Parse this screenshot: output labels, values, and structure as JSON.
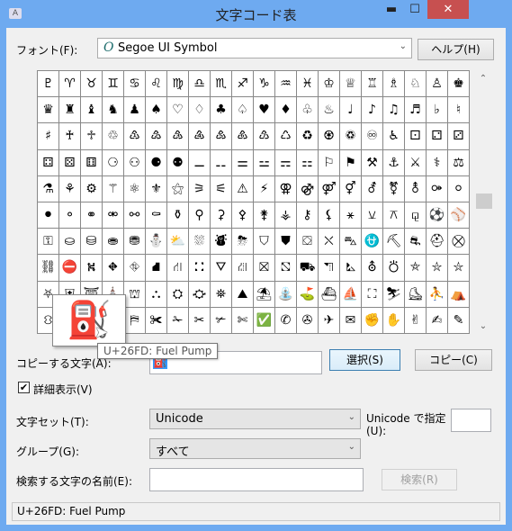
{
  "window": {
    "title": "文字コード表",
    "minimize": "▬",
    "maximize": "☐",
    "close": "✕",
    "app_icon": "A"
  },
  "font": {
    "label": "フォント(F):",
    "value": "Segoe UI Symbol",
    "font_icon": "O",
    "arrow": "⌄"
  },
  "help_button": "ヘルプ(H)",
  "grid": {
    "rows": [
      "♇♈♉♊♋♌♍♎♏♐♑♒♓♔♕♖♗♘♙♚",
      "♛♜♝♞♟♠♡♢♣♤♥♦♧♨♩♪♫♬♭♮",
      "♯♰♱♲♳♴♵♶♷♸♹♺♻♼♽♾♿⚀⚁⚂",
      "⚃⚄⚅⚆⚇⚈⚉⚊⚋⚌⚍⚎⚏⚐⚑⚒⚓⚔⚕⚖",
      "⚗⚘⚙⚚⚛⚜⚝⚞⚟⚠⚡⚢⚣⚤⚥⚦⚧⚨⚩⚪",
      "⚫⚬⚭⚮⚯⚰⚱⚲⚳⚴⚵⚶⚷⚸⚹⚺⚻⚼⚽⚾",
      "⚿⛀⛁⛂⛃⛄⛅⛆⛇⛈⛉⛊⛋⛌⛍⛎⛏⛐⛑⛒",
      "⛓⛔⛕⛖⛗⛘⛙⛚⛛⛜⛝⛞⛟⛠⛡⛢⛣⛤⛥⛦",
      "⛧⛨⛩⛪⛫⛬⛭⛮⛯⛰⛱⛲⛳⛴⛵⛶⛷⛸⛹⛺",
      "⛻⛼⛽⛾⛿✀✁✂✃✄✅✆✇✈✉✊✋✌✍✎"
    ],
    "scroll_up": "⌃",
    "scroll_down": "⌄",
    "magnified_char": "⛽",
    "tooltip": "U+26FD: Fuel Pump"
  },
  "copy": {
    "label": "コピーする文字(A):",
    "value": "⛽",
    "select_button": "選択(S)",
    "copy_button": "コピー(C)"
  },
  "advanced": {
    "label": "詳細表示(V)",
    "checked": true,
    "check_mark": "✔"
  },
  "charset": {
    "label": "文字セット(T):",
    "value": "Unicode",
    "arrow": "⌄"
  },
  "unicode_goto": {
    "label_line1": "Unicode で指定",
    "label_line2": "(U):",
    "value": ""
  },
  "group": {
    "label": "グループ(G):",
    "value": "すべて",
    "arrow": "⌄"
  },
  "search": {
    "label": "検索する文字の名前(E):",
    "value": "",
    "button": "検索(R)"
  },
  "status": "U+26FD: Fuel Pump"
}
